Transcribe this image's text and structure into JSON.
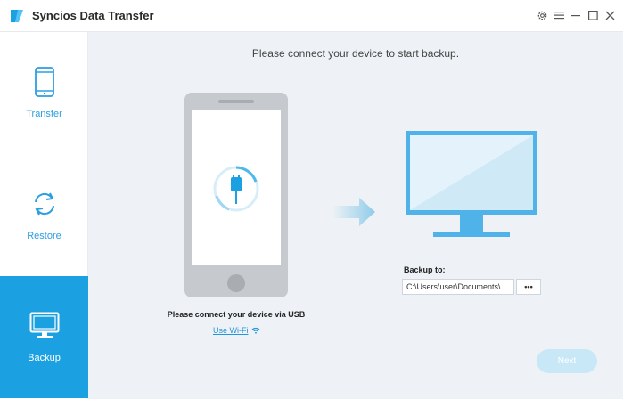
{
  "window": {
    "title": "Syncios Data Transfer",
    "controls": [
      "gear-icon",
      "menu-icon",
      "minimize-icon",
      "maximize-icon",
      "close-icon"
    ]
  },
  "sidebar": {
    "items": [
      {
        "label": "Transfer",
        "icon": "phone-icon",
        "active": false
      },
      {
        "label": "Restore",
        "icon": "refresh-icon",
        "active": false
      },
      {
        "label": "Backup",
        "icon": "monitor-icon",
        "active": true
      }
    ]
  },
  "main": {
    "instruction": "Please connect your device to start backup.",
    "connect_text": "Please connect your device via USB",
    "wifi_link": "Use Wi-Fi",
    "backup_label": "Backup to:",
    "backup_path": "C:\\Users\\user\\Documents\\...",
    "browse_label": "•••",
    "next_label": "Next"
  },
  "colors": {
    "accent": "#1ba1e2",
    "main_bg": "#eef2f6",
    "next_disabled": "#c9e8f7"
  }
}
